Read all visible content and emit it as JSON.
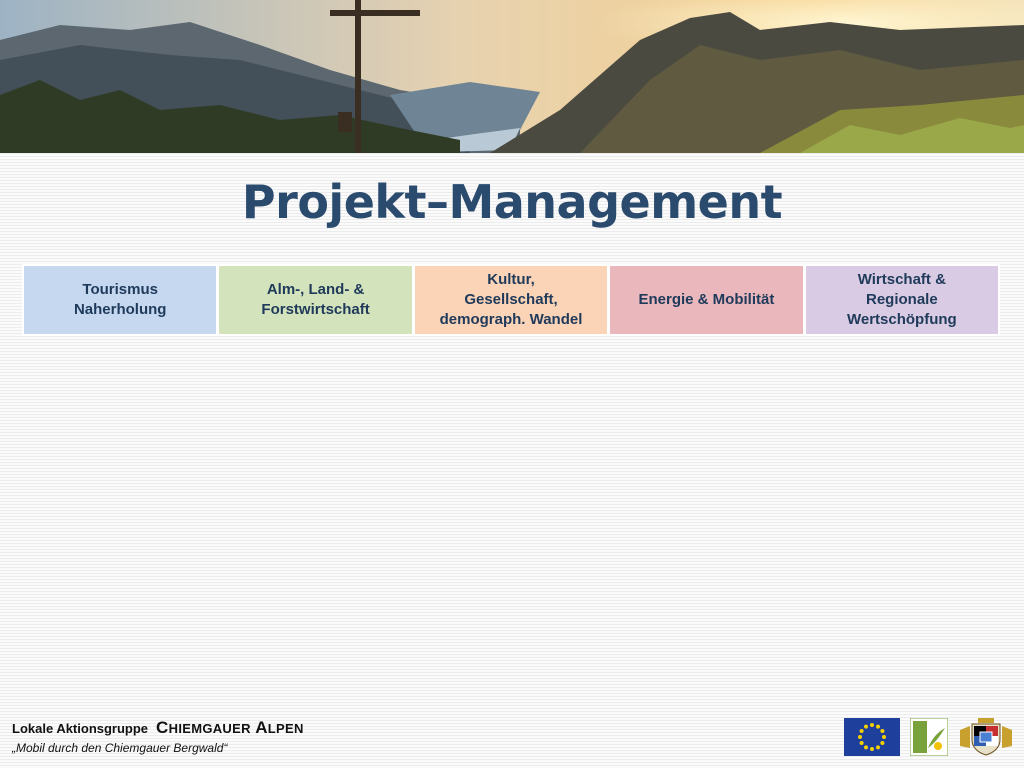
{
  "title": "Projekt–Management",
  "categories": [
    {
      "label": "Tourismus\nNaherholung",
      "color": "#c5d8f0"
    },
    {
      "label": "Alm-, Land- &\nForstwirtschaft",
      "color": "#d3e3bb"
    },
    {
      "label": "Kultur,\nGesellschaft,\ndemograph. Wandel",
      "color": "#fbd3b6"
    },
    {
      "label": "Energie & Mobilität",
      "color": "#e9b7bc"
    },
    {
      "label": "Wirtschaft &\nRegionale\nWertschöpfung",
      "color": "#d8cbe3"
    }
  ],
  "footer": {
    "group_label": "Lokale Aktionsgruppe",
    "brand": "Chiemgauer Alpen",
    "slogan": "„Mobil durch den Chiemgauer Bergwald“"
  },
  "icons": [
    "eu-flag-icon",
    "leader-logo-icon",
    "bavaria-coat-of-arms-icon"
  ],
  "colors": {
    "title": "#2a4a6e",
    "category_text": "#1f3a5a"
  }
}
